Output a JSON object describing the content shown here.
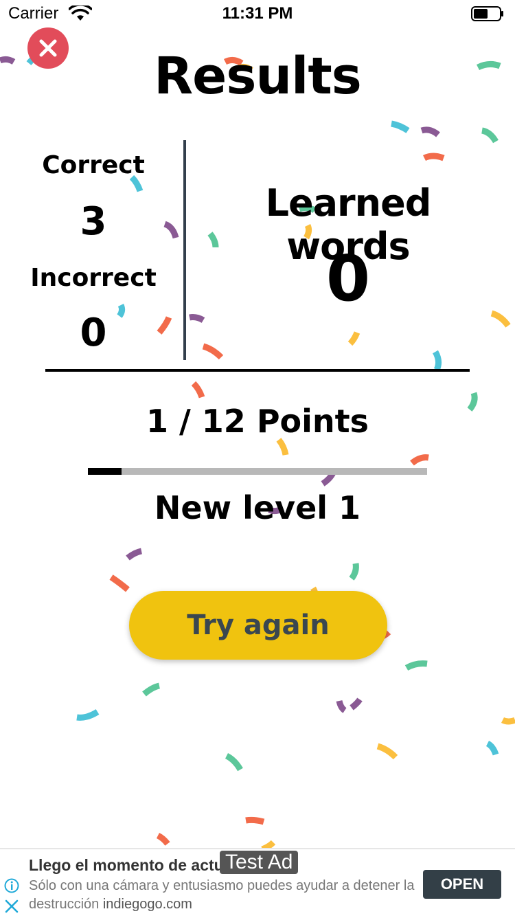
{
  "status_bar": {
    "carrier": "Carrier",
    "time": "11:31 PM"
  },
  "header": {
    "title": "Results",
    "close_icon": "close-x-icon"
  },
  "stats": {
    "correct_label": "Correct",
    "correct_value": "3",
    "incorrect_label": "Incorrect",
    "incorrect_value": "0",
    "learned_label": "Learned words",
    "learned_value": "0"
  },
  "progress": {
    "points_text": "1 / 12 Points",
    "fraction": 0.1,
    "level_text": "New level 1"
  },
  "actions": {
    "try_again_label": "Try again"
  },
  "ad": {
    "title": "Llego el momento de actu",
    "badge": "Test Ad",
    "description": "Sólo con una cámara y entusiasmo puedes ayudar a detener la destrucción",
    "domain": "indiegogo.com",
    "open_label": "OPEN"
  },
  "colors": {
    "close_button": "#e24c5a",
    "try_again_button": "#f0c30f",
    "divider": "#333f4c",
    "confetti": [
      "#f26b4a",
      "#4ec3d8",
      "#8a5a94",
      "#5cc79a",
      "#fbbf3f"
    ]
  }
}
